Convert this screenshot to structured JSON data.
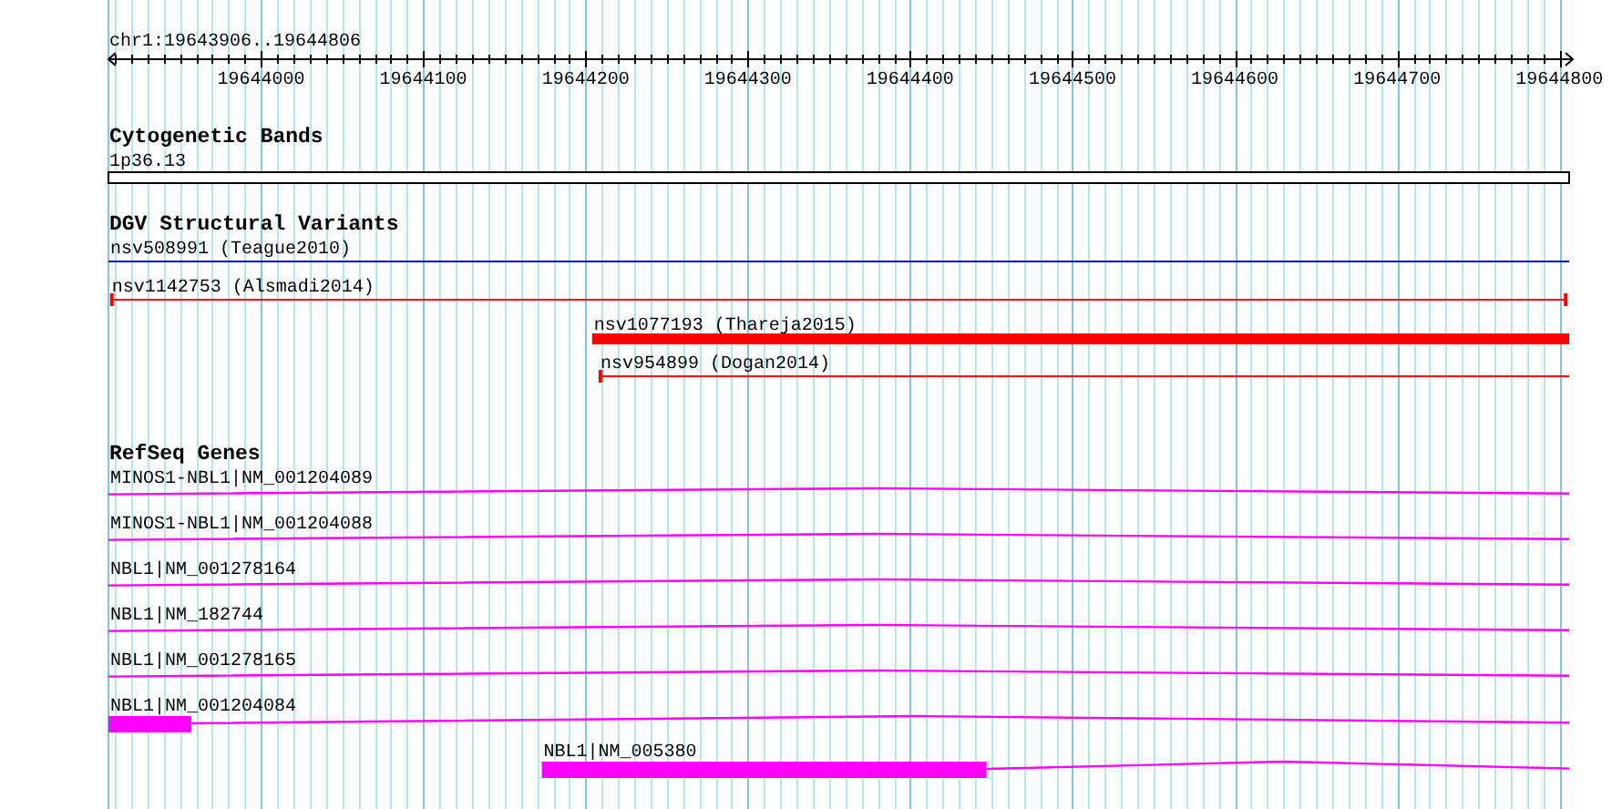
{
  "view": {
    "region": "chr1:19643906..19644806"
  },
  "ruler": {
    "tick_labels": [
      "19644000",
      "19644100",
      "19644200",
      "19644300",
      "19644400",
      "19644500",
      "19644600",
      "19644700",
      "19644800"
    ]
  },
  "tracks": [
    {
      "kind": "cytoband",
      "title": "Cytogenetic Bands",
      "features": [
        {
          "label": "1p36.13"
        }
      ]
    },
    {
      "kind": "variants",
      "title": "DGV Structural Variants",
      "features": [
        {
          "label": "nsv508991 (Teague2010)",
          "kind": "line",
          "color": "#0000cc"
        },
        {
          "label": "nsv1142753 (Alsmadi2014)",
          "kind": "line",
          "color": "#ff0000"
        },
        {
          "label": "nsv1077193 (Thareja2015)",
          "kind": "bar",
          "color": "#ff0000"
        },
        {
          "label": "nsv954899 (Dogan2014)",
          "kind": "line",
          "color": "#ff0000"
        }
      ]
    },
    {
      "kind": "genes",
      "title": "RefSeq Genes",
      "features": [
        {
          "label": "MINOS1-NBL1|NM_001204089",
          "color": "#ff00ff"
        },
        {
          "label": "MINOS1-NBL1|NM_001204088",
          "color": "#ff00ff"
        },
        {
          "label": "NBL1|NM_001278164",
          "color": "#ff00ff"
        },
        {
          "label": "NBL1|NM_182744",
          "color": "#ff00ff"
        },
        {
          "label": "NBL1|NM_001278165",
          "color": "#ff00ff"
        },
        {
          "label": "NBL1|NM_001204084",
          "color": "#ff00ff"
        },
        {
          "label": "NBL1|NM_005380",
          "color": "#ff00ff"
        }
      ]
    }
  ]
}
